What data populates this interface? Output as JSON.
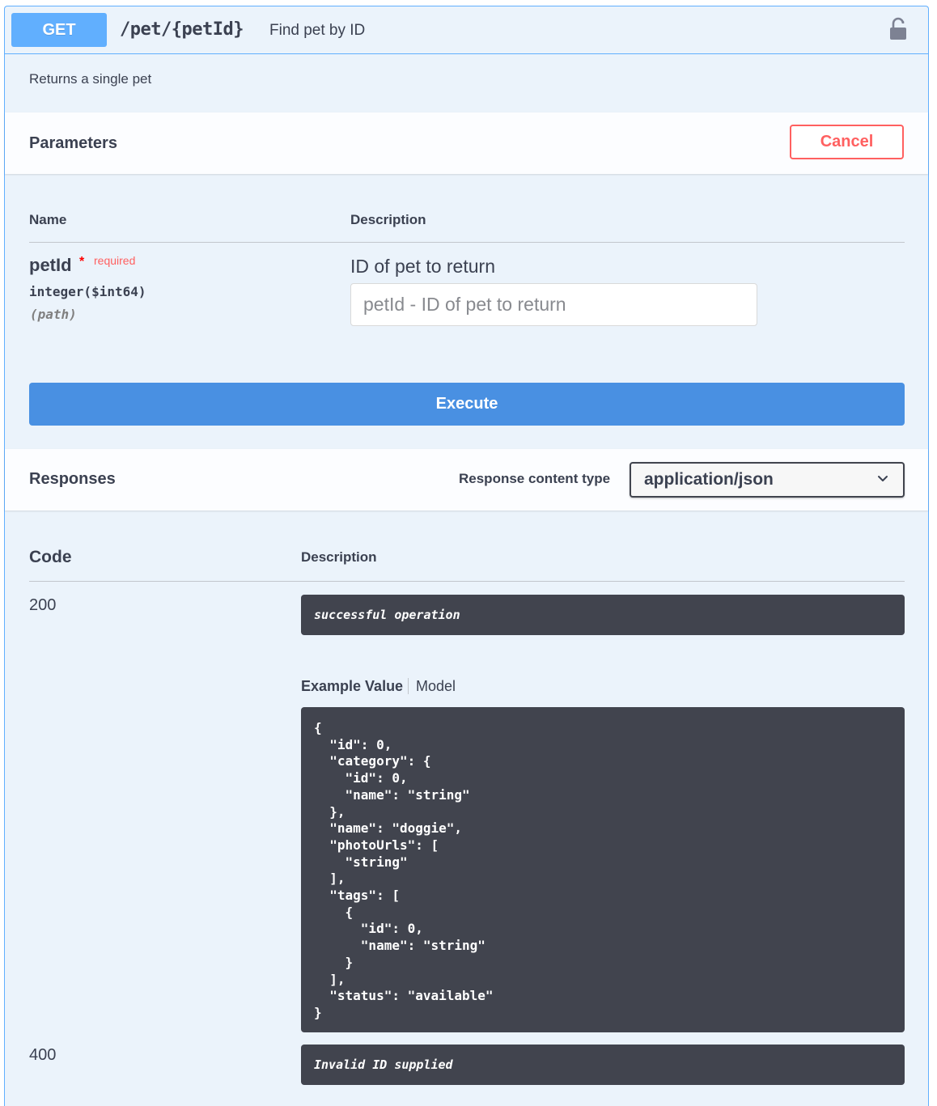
{
  "operation": {
    "method": "GET",
    "path": "/pet/{petId}",
    "summary": "Find pet by ID",
    "description": "Returns a single pet",
    "lock_icon": "unlocked-padlock-icon"
  },
  "parameters": {
    "title": "Parameters",
    "cancel_label": "Cancel",
    "col_name": "Name",
    "col_description": "Description",
    "items": [
      {
        "name": "petId",
        "required_star": "*",
        "required_label": "required",
        "type": "integer($int64)",
        "in": "(path)",
        "description": "ID of pet to return",
        "input_placeholder": "petId - ID of pet to return",
        "input_value": ""
      }
    ],
    "execute_label": "Execute"
  },
  "responses": {
    "title": "Responses",
    "content_type_label": "Response content type",
    "content_type_value": "application/json",
    "col_code": "Code",
    "col_description": "Description",
    "items": [
      {
        "code": "200",
        "description": "successful operation",
        "tab_example": "Example Value",
        "tab_model": "Model",
        "example": "{\n  \"id\": 0,\n  \"category\": {\n    \"id\": 0,\n    \"name\": \"string\"\n  },\n  \"name\": \"doggie\",\n  \"photoUrls\": [\n    \"string\"\n  ],\n  \"tags\": [\n    {\n      \"id\": 0,\n      \"name\": \"string\"\n    }\n  ],\n  \"status\": \"available\"\n}"
      },
      {
        "code": "400",
        "description": "Invalid ID supplied"
      }
    ]
  },
  "colors": {
    "get_blue": "#61affe",
    "execute_blue": "#4990e2",
    "cancel_red": "#ff6060",
    "dark_box": "#41444e",
    "panel_bg": "#ebf3fb"
  }
}
